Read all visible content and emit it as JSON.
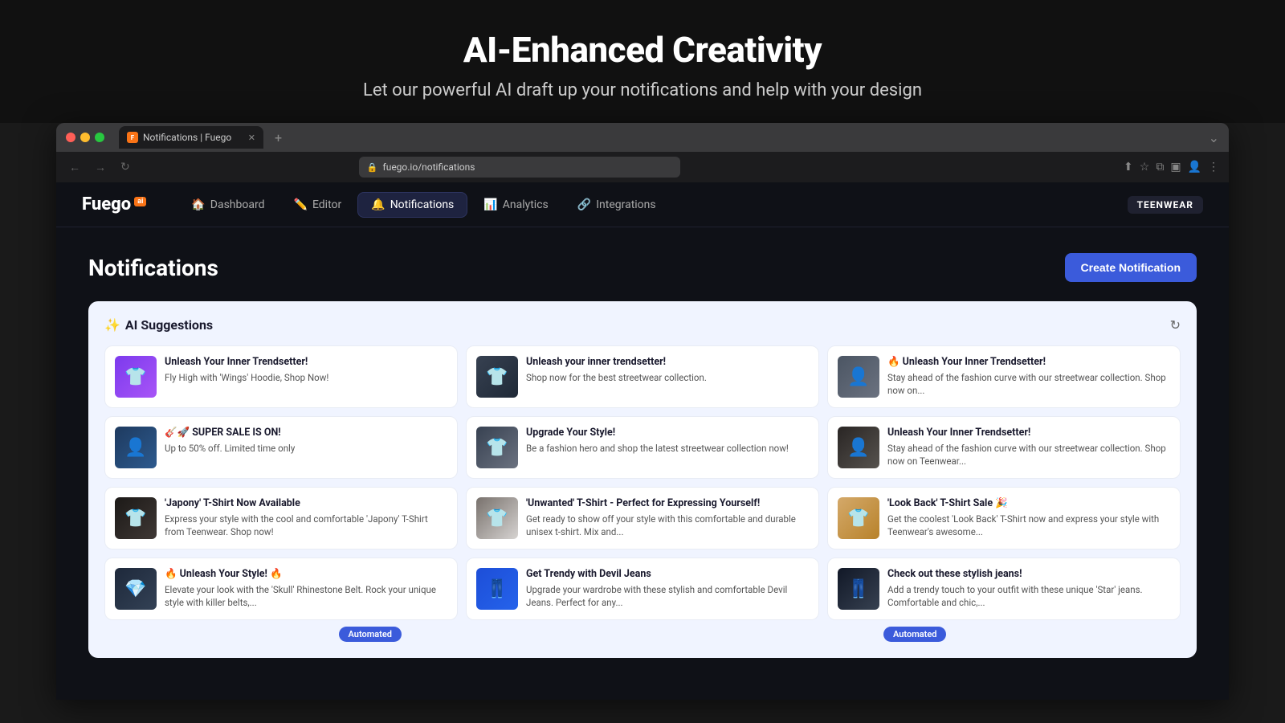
{
  "hero": {
    "title": "AI-Enhanced Creativity",
    "subtitle": "Let our powerful AI draft up your notifications and help with your design"
  },
  "browser": {
    "tab_title": "Notifications | Fuego",
    "url": "fuego.io/notifications",
    "url_base": "fuego.io",
    "url_path": "/notifications"
  },
  "nav": {
    "logo": "Fuego",
    "logo_superscript": "ai",
    "items": [
      {
        "label": "Dashboard",
        "icon": "🏠",
        "active": false
      },
      {
        "label": "Editor",
        "icon": "✏️",
        "active": false
      },
      {
        "label": "Notifications",
        "icon": "🔔",
        "active": true
      },
      {
        "label": "Analytics",
        "icon": "📊",
        "active": false
      },
      {
        "label": "Integrations",
        "icon": "🔗",
        "active": false
      }
    ],
    "brand": "TEENWEAR"
  },
  "page": {
    "title": "Notifications",
    "create_button": "Create Notification"
  },
  "ai_panel": {
    "title": "AI Suggestions",
    "title_icon": "✨",
    "refresh_icon": "↻",
    "notifications": [
      {
        "img_class": "img-purple",
        "heading": "Unleash Your Inner Trendsetter!",
        "body": "Fly High with 'Wings' Hoodie, Shop Now!",
        "img_emoji": "👕"
      },
      {
        "img_class": "img-dark",
        "heading": "Unleash your inner trendsetter!",
        "body": "Shop now for the best streetwear collection.",
        "img_emoji": "👕"
      },
      {
        "img_class": "img-street",
        "heading": "🔥 Unleash Your Inner Trendsetter!",
        "body": "Stay ahead of the fashion curve with our streetwear collection. Shop now on...",
        "img_emoji": "👤"
      },
      {
        "img_class": "img-fashion1",
        "heading": "🎸🚀 SUPER SALE IS ON!",
        "body": "Up to 50% off. Limited time only",
        "img_emoji": "👤"
      },
      {
        "img_class": "img-fashion2",
        "heading": "Upgrade Your Style!",
        "body": "Be a fashion hero and shop the latest streetwear collection now!",
        "img_emoji": "👕"
      },
      {
        "img_class": "img-fashion3",
        "heading": "Unleash Your Inner Trendsetter!",
        "body": "Stay ahead of the fashion curve with our streetwear collection. Shop now on Teenwear...",
        "img_emoji": "👤"
      },
      {
        "img_class": "img-tshirt1",
        "heading": "'Japony' T-Shirt Now Available",
        "body": "Express your style with the cool and comfortable 'Japony' T-Shirt from Teenwear. Shop now!",
        "img_emoji": "👕"
      },
      {
        "img_class": "img-tshirt2",
        "heading": "'Unwanted' T-Shirt - Perfect for Expressing Yourself!",
        "body": "Get ready to show off your style with this comfortable and durable unisex t-shirt. Mix and...",
        "img_emoji": "👕"
      },
      {
        "img_class": "img-tshirt3",
        "heading": "'Look Back' T-Shirt Sale 🎉",
        "body": "Get the coolest 'Look Back' T-Shirt now and express your style with Teenwear's awesome...",
        "img_emoji": "👕"
      },
      {
        "img_class": "img-belt",
        "heading": "🔥 Unleash Your Style! 🔥",
        "body": "Elevate your look with the 'Skull' Rhinestone Belt. Rock your unique style with killer belts,...",
        "img_emoji": "💎"
      },
      {
        "img_class": "img-jeans1",
        "heading": "Get Trendy with Devil Jeans",
        "body": "Upgrade your wardrobe with these stylish and comfortable Devil Jeans. Perfect for any...",
        "img_emoji": "👖"
      },
      {
        "img_class": "img-jeans2",
        "heading": "Check out these stylish jeans!",
        "body": "Add a trendy touch to your outfit with these unique 'Star' jeans. Comfortable and chic,...",
        "img_emoji": "👖"
      }
    ],
    "bottom_tag": "Automated"
  }
}
